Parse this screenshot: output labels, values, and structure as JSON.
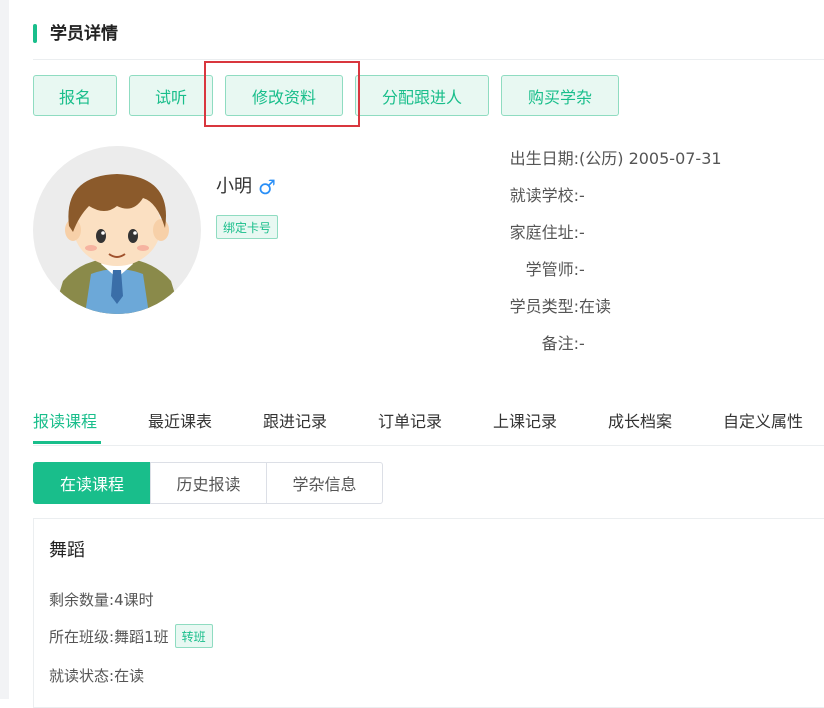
{
  "header": {
    "title": "学员详情"
  },
  "actions": [
    {
      "label": "报名"
    },
    {
      "label": "试听"
    },
    {
      "label": "修改资料"
    },
    {
      "label": "分配跟进人"
    },
    {
      "label": "购买学杂"
    }
  ],
  "student": {
    "name": "小明",
    "gender_symbol": "♂",
    "bind_card_label": "绑定卡号"
  },
  "info": [
    {
      "label": "出生日期:",
      "value": "(公历) 2005-07-31"
    },
    {
      "label": "就读学校:",
      "value": "-"
    },
    {
      "label": "家庭住址:",
      "value": "-"
    },
    {
      "label": "学管师:",
      "value": "-"
    },
    {
      "label": "学员类型:",
      "value": "在读"
    },
    {
      "label": "备注:",
      "value": "-"
    }
  ],
  "tabs": [
    {
      "label": "报读课程"
    },
    {
      "label": "最近课表"
    },
    {
      "label": "跟进记录"
    },
    {
      "label": "订单记录"
    },
    {
      "label": "上课记录"
    },
    {
      "label": "成长档案"
    },
    {
      "label": "自定义属性"
    }
  ],
  "subtabs": [
    {
      "label": "在读课程"
    },
    {
      "label": "历史报读"
    },
    {
      "label": "学杂信息"
    }
  ],
  "course": {
    "name": "舞蹈",
    "remaining_label": "剩余数量:",
    "remaining_value": "4课时",
    "class_label": "所在班级:",
    "class_value": "舞蹈1班",
    "transfer_label": "转班",
    "status_label": "就读状态:",
    "status_value": "在读"
  },
  "colors": {
    "accent": "#19be8b",
    "highlight": "#d9363e",
    "male": "#2a8ff7"
  }
}
